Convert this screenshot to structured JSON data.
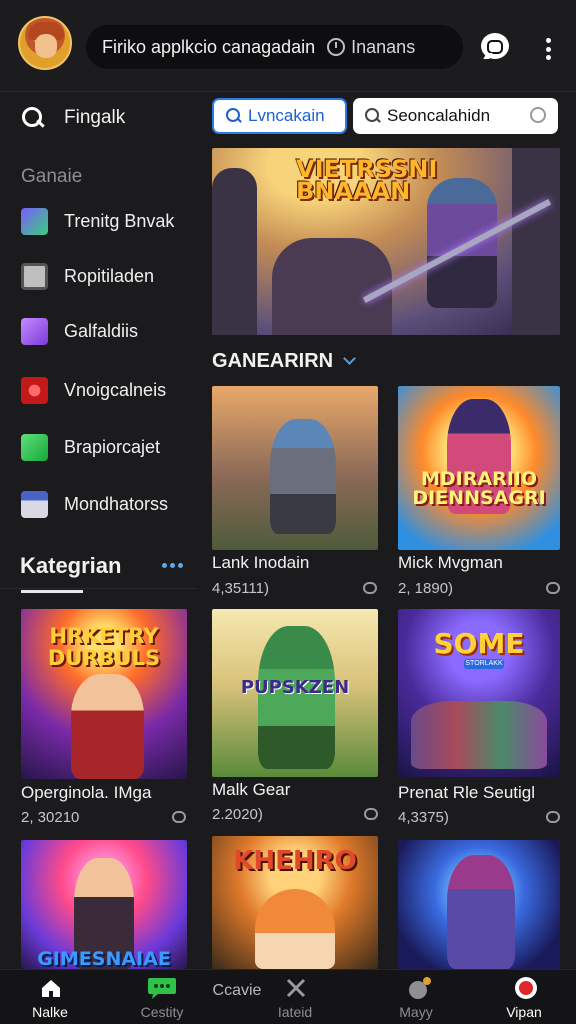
{
  "header": {
    "search_text": "Firiko applkcio canagadain",
    "status_text": "Inanans"
  },
  "sidebar": {
    "search_label": "Fingalk",
    "heading": "Ganaie",
    "items": [
      {
        "label": "Trenitg Bnvak",
        "icon": "trending-icon"
      },
      {
        "label": "Ropitiladen",
        "icon": "library-icon"
      },
      {
        "label": "Galfaldiis",
        "icon": "gallery-icon"
      },
      {
        "label": "Vnoigcalneis",
        "icon": "news-icon"
      },
      {
        "label": "Brapiorcajet",
        "icon": "projects-icon"
      },
      {
        "label": "Mondhatorss",
        "icon": "monitor-icon"
      }
    ],
    "categories_title": "Kategrian"
  },
  "filters": {
    "active": "Lvncakain",
    "other": "Seoncalahidn"
  },
  "hero": {
    "title": "VIETRSSNI BNAAAN"
  },
  "section": {
    "title": "GANEARIRN"
  },
  "cards": [
    {
      "title": "Lank Inodain",
      "meta": "4,35111)",
      "art_text": ""
    },
    {
      "title": "Mick Mvgman",
      "meta": "2, 1890)",
      "art_text": "MDIRARIIO DIENNSAGRI"
    },
    {
      "title": "Operginola. IMga",
      "meta": "2, 30210",
      "art_text": "HRKETRY DURBULS"
    },
    {
      "title": "Malk Gear",
      "meta": "2.2020)",
      "art_text": "PUPSKZEN"
    },
    {
      "title": "Prenat Rle Seutigl",
      "meta": "4,3375)",
      "art_text": "SOME"
    },
    {
      "title": "",
      "meta": "",
      "art_text": "GIMESNAIAE"
    },
    {
      "title": "",
      "meta": "",
      "art_text": "KHEHRO"
    },
    {
      "title": "",
      "meta": "",
      "art_text": ""
    }
  ],
  "card_badge_text": "STORLAKK",
  "bottom_nav": [
    {
      "label": "Nalke",
      "icon": "home-icon",
      "active": true
    },
    {
      "label": "Cestity",
      "icon": "chat-icon",
      "active": false
    },
    {
      "label": "Ccavie",
      "icon": "",
      "active": false
    },
    {
      "label": "Iateid",
      "icon": "tools-icon",
      "active": false
    },
    {
      "label": "Mayy",
      "icon": "planet-icon",
      "active": false
    },
    {
      "label": "Vipan",
      "icon": "record-icon",
      "active": true
    }
  ],
  "colors": {
    "accent": "#2c7be5",
    "background": "#1b1b1d"
  }
}
